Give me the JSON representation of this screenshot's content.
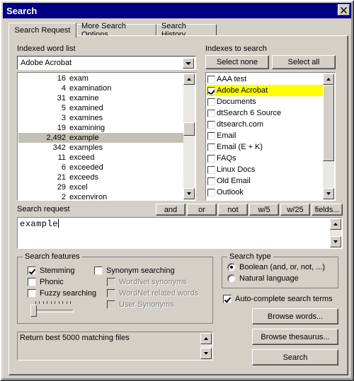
{
  "window": {
    "title": "Search",
    "close_label": "✕"
  },
  "tabs": [
    {
      "label": "Search Request",
      "active": true
    },
    {
      "label": "More Search Options",
      "active": false
    },
    {
      "label": "Search History",
      "active": false
    }
  ],
  "indexed_word_list": {
    "label": "Indexed word list",
    "combo_value": "Adobe Acrobat",
    "rows": [
      {
        "count": "16",
        "word": "exam",
        "selected": false
      },
      {
        "count": "4",
        "word": "examination",
        "selected": false
      },
      {
        "count": "31",
        "word": "examine",
        "selected": false
      },
      {
        "count": "5",
        "word": "examined",
        "selected": false
      },
      {
        "count": "3",
        "word": "examines",
        "selected": false
      },
      {
        "count": "19",
        "word": "examining",
        "selected": false
      },
      {
        "count": "2,492",
        "word": "example",
        "selected": true
      },
      {
        "count": "342",
        "word": "examples",
        "selected": false
      },
      {
        "count": "11",
        "word": "exceed",
        "selected": false
      },
      {
        "count": "6",
        "word": "exceeded",
        "selected": false
      },
      {
        "count": "21",
        "word": "exceeds",
        "selected": false
      },
      {
        "count": "29",
        "word": "excel",
        "selected": false
      },
      {
        "count": "2",
        "word": "excenviron",
        "selected": false
      }
    ]
  },
  "indexes_to_search": {
    "label": "Indexes to search",
    "select_none_label": "Select none",
    "select_all_label": "Select all",
    "items": [
      {
        "label": "AAA test",
        "checked": false,
        "highlighted": false
      },
      {
        "label": "Adobe Acrobat",
        "checked": true,
        "highlighted": true
      },
      {
        "label": "Documents",
        "checked": false,
        "highlighted": false
      },
      {
        "label": "dtSearch 6 Source",
        "checked": false,
        "highlighted": false
      },
      {
        "label": "dtsearch.com",
        "checked": false,
        "highlighted": false
      },
      {
        "label": "Email",
        "checked": false,
        "highlighted": false
      },
      {
        "label": "Email (E + K)",
        "checked": false,
        "highlighted": false
      },
      {
        "label": "FAQs",
        "checked": false,
        "highlighted": false
      },
      {
        "label": "Linux Docs",
        "checked": false,
        "highlighted": false
      },
      {
        "label": "Old Email",
        "checked": false,
        "highlighted": false
      },
      {
        "label": "Outlook",
        "checked": false,
        "highlighted": false
      }
    ]
  },
  "operator_buttons": [
    {
      "label": "and"
    },
    {
      "label": "or"
    },
    {
      "label": "not"
    },
    {
      "label": "w/5"
    },
    {
      "label": "w/25"
    },
    {
      "label": "fields..."
    }
  ],
  "search_request": {
    "label": "Search request",
    "value": "example"
  },
  "search_features": {
    "title": "Search features",
    "stemming": {
      "label": "Stemming",
      "checked": true,
      "disabled": false
    },
    "phonic": {
      "label": "Phonic",
      "checked": false,
      "disabled": false
    },
    "fuzzy": {
      "label": "Fuzzy searching",
      "checked": false,
      "disabled": false
    },
    "synonym": {
      "label": "Synonym searching",
      "checked": false,
      "disabled": false
    },
    "wordnet_synonyms": {
      "label": "WordNet synonyms",
      "checked": false,
      "disabled": true
    },
    "wordnet_related": {
      "label": "WordNet related words",
      "checked": false,
      "disabled": true
    },
    "user_synonyms": {
      "label": "User Synonyms",
      "checked": false,
      "disabled": true
    },
    "fuzzy_level": 0
  },
  "search_type": {
    "title": "Search type",
    "boolean": {
      "label": "Boolean (and, or, not, ...)",
      "selected": true
    },
    "natural": {
      "label": "Natural language",
      "selected": false
    }
  },
  "autocomplete": {
    "label": "Auto-complete search terms",
    "checked": true
  },
  "action_buttons": [
    {
      "label": "Browse words..."
    },
    {
      "label": "Browse thesaurus..."
    },
    {
      "label": "Search"
    }
  ],
  "status": {
    "text": "Return best 5000 matching files"
  },
  "colors": {
    "titlebar": "#000080",
    "face": "#d4d0c8",
    "highlight": "#ffff00",
    "selection": "#c3c1b4"
  }
}
